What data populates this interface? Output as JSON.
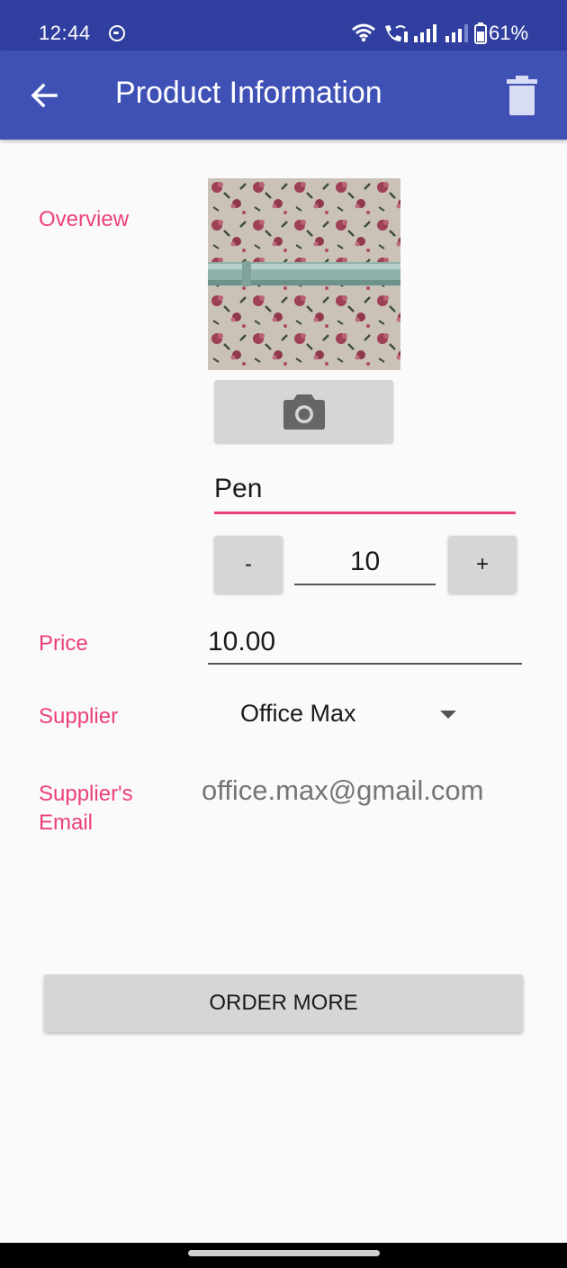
{
  "status_bar": {
    "time": "12:44",
    "battery": "61%"
  },
  "app_bar": {
    "title": "Product Information",
    "back_icon": "arrow-back-icon",
    "delete_icon": "trash-icon",
    "color": "#3f51b5"
  },
  "form": {
    "overview_label": "Overview",
    "camera_icon": "camera-icon",
    "product_name": "Pen",
    "quantity": {
      "decrement_label": "-",
      "value": "10",
      "increment_label": "+"
    },
    "price_label": "Price",
    "price_value": "10.00",
    "supplier_label": "Supplier",
    "supplier_value": "Office Max",
    "email_label": "Supplier's Email",
    "email_value": "office.max@gmail.com",
    "label_color": "#ec407a"
  },
  "actions": {
    "order_more_label": "ORDER MORE"
  }
}
